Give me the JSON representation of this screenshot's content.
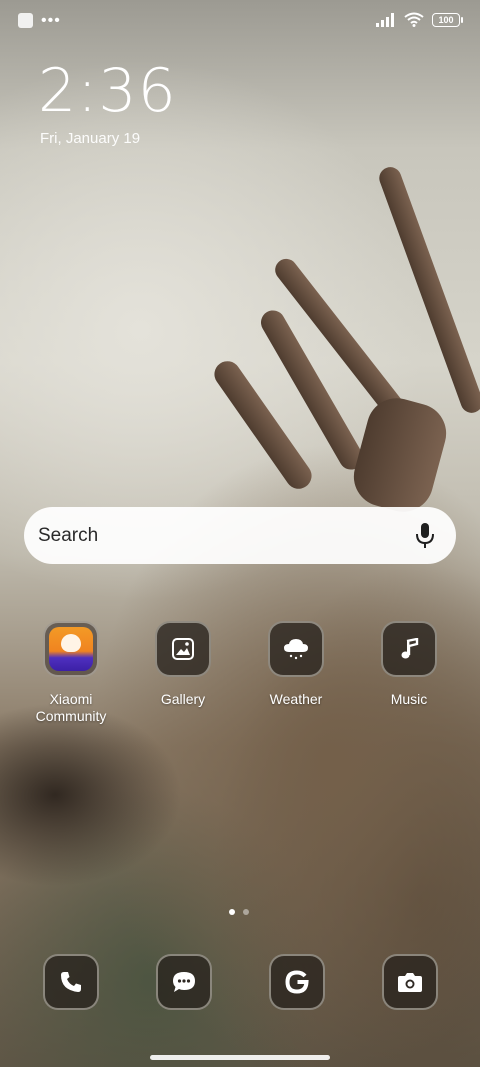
{
  "status_bar": {
    "notification_icons": [
      "app-notification-icon",
      "more-notifications-icon"
    ],
    "system_icons": [
      "signal-icon",
      "wifi-icon",
      "battery-icon"
    ],
    "battery_level": "100"
  },
  "clock": {
    "time": "2:36",
    "date": "Fri, January 19"
  },
  "search": {
    "placeholder": "Search",
    "icon": "microphone-icon"
  },
  "apps": [
    {
      "label": "Xiaomi Community",
      "icon": "xiaomi-community-icon"
    },
    {
      "label": "Gallery",
      "icon": "gallery-icon"
    },
    {
      "label": "Weather",
      "icon": "weather-icon"
    },
    {
      "label": "Music",
      "icon": "music-icon"
    }
  ],
  "page_indicator": {
    "count": 2,
    "active": 1
  },
  "dock": [
    {
      "icon": "phone-icon"
    },
    {
      "icon": "messages-icon"
    },
    {
      "icon": "google-icon"
    },
    {
      "icon": "camera-icon"
    }
  ],
  "colors": {
    "search_bar": "#f2f1ee",
    "icon_tile": "#2e2823"
  }
}
